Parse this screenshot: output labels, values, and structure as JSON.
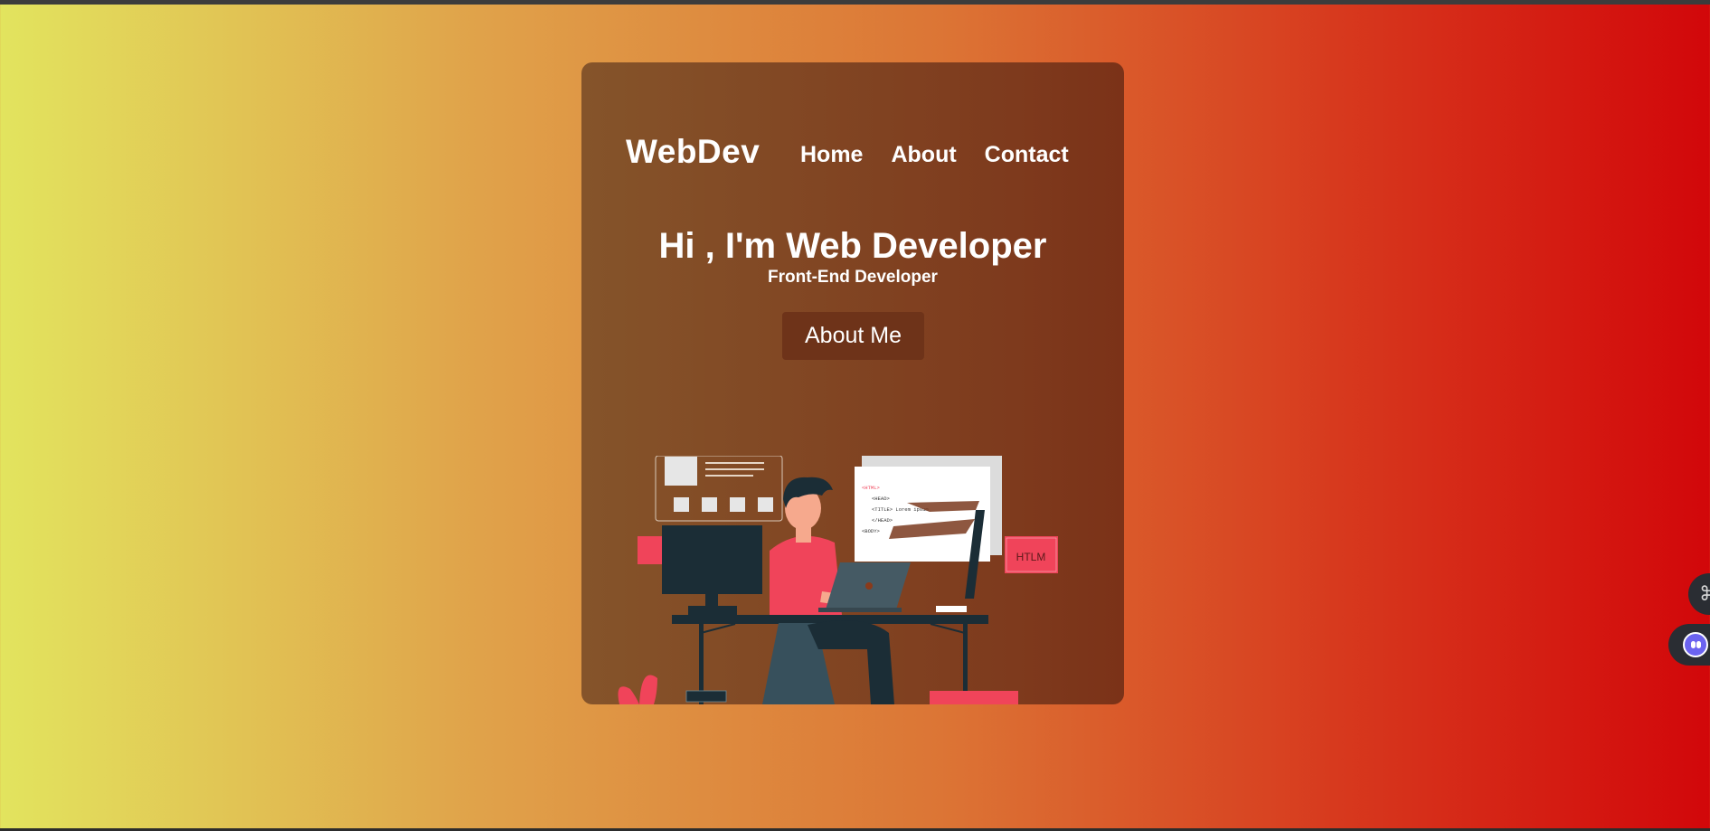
{
  "header": {
    "logo": "WebDev",
    "nav": [
      {
        "label": "Home"
      },
      {
        "label": "About"
      },
      {
        "label": "Contact"
      }
    ]
  },
  "hero": {
    "title": "Hi , I'm Web Developer",
    "subtitle": "Front-End Developer",
    "button_label": "About Me"
  },
  "illustration": {
    "icon": "developer-at-desk-illustration",
    "code_lines": [
      "<HTML>",
      "<HEAD>",
      "<TITLE> Lorem ipsum",
      "</HEAD>",
      "<BODY>"
    ],
    "badge": "HTLM"
  },
  "floating_buttons": [
    {
      "icon": "command-icon"
    },
    {
      "icon": "assistant-bot-icon"
    }
  ],
  "colors": {
    "bg_gradient": [
      "#e2e45e",
      "#e0a24a",
      "#dc7535",
      "#d73a1e",
      "#d2070a"
    ],
    "card": "#85542a",
    "button": "#6e3319",
    "accent_red": "#f0445a",
    "dark_navy": "#1b2d36"
  }
}
